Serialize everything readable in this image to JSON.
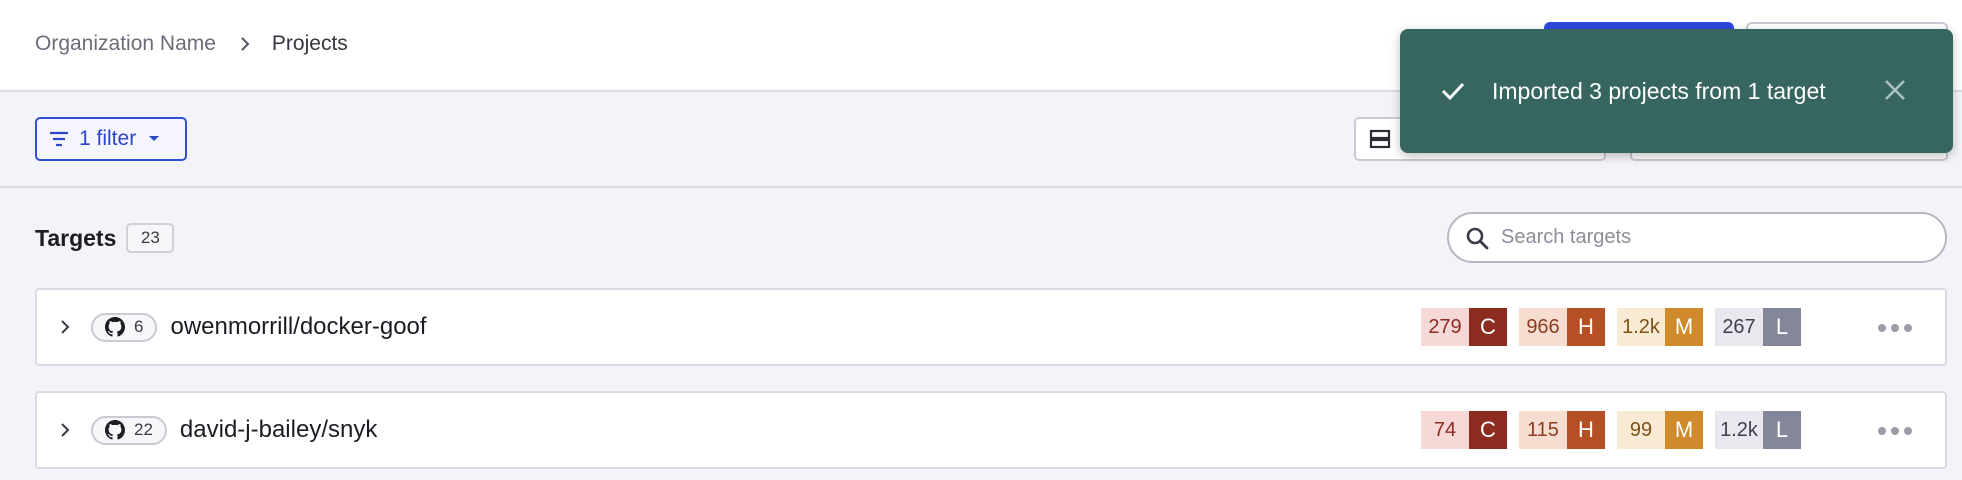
{
  "breadcrumb": {
    "org": "Organization Name",
    "current": "Projects"
  },
  "toolbar": {
    "filter_label": "1 filter"
  },
  "targets": {
    "title": "Targets",
    "count": "23",
    "search_placeholder": "Search targets"
  },
  "rows": [
    {
      "repo_count": "6",
      "name": "owenmorrill/docker-goof",
      "issues": {
        "critical": "279",
        "critical_label": "C",
        "high": "966",
        "high_label": "H",
        "medium": "1.2k",
        "medium_label": "M",
        "low": "267",
        "low_label": "L"
      }
    },
    {
      "repo_count": "22",
      "name": "david-j-bailey/snyk",
      "issues": {
        "critical": "74",
        "critical_label": "C",
        "high": "115",
        "high_label": "H",
        "medium": "99",
        "medium_label": "M",
        "low": "1.2k",
        "low_label": "L"
      }
    }
  ],
  "toast": {
    "message": "Imported 3 projects from 1 target"
  },
  "icons": {
    "breadcrumb_separator": "chevron-right-icon",
    "filter": "filter-lines-icon",
    "caret": "caret-down-icon",
    "view": "list-view-icon",
    "search": "search-icon",
    "expand": "chevron-right-icon",
    "repo": "github-icon",
    "more": "more-horizontal-icon",
    "toast_check": "check-icon",
    "toast_close": "close-icon"
  },
  "colors": {
    "primary": "#2c49e0",
    "toast_bg": "#376660",
    "critical": "#8c2b20",
    "high": "#b54f24",
    "medium": "#cf8a2c",
    "low": "#84869a"
  }
}
